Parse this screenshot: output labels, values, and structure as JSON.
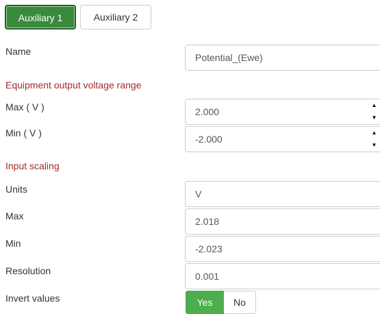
{
  "tabs": [
    {
      "label": "Auxiliary 1"
    },
    {
      "label": "Auxiliary 2"
    }
  ],
  "name": {
    "label": "Name",
    "value": "Potential_(Ewe)"
  },
  "equipment_range": {
    "heading": "Equipment output voltage range",
    "max": {
      "label": "Max ( V )",
      "value": "2.000"
    },
    "min": {
      "label": "Min ( V )",
      "value": "-2.000"
    }
  },
  "input_scaling": {
    "heading": "Input scaling",
    "units": {
      "label": "Units",
      "value": "V"
    },
    "max": {
      "label": "Max",
      "value": "2.018"
    },
    "min": {
      "label": "Min",
      "value": "-2.023"
    },
    "resolution": {
      "label": "Resolution",
      "value": "0.001"
    }
  },
  "invert": {
    "label": "Invert values",
    "yes": "Yes",
    "no": "No",
    "selected": "Yes"
  },
  "spinner": {
    "up": "▲",
    "down": "▼"
  },
  "colors": {
    "active_tab": "#3a8a3e",
    "section_heading": "#a52a2a",
    "toggle_yes": "#4cae4c"
  }
}
